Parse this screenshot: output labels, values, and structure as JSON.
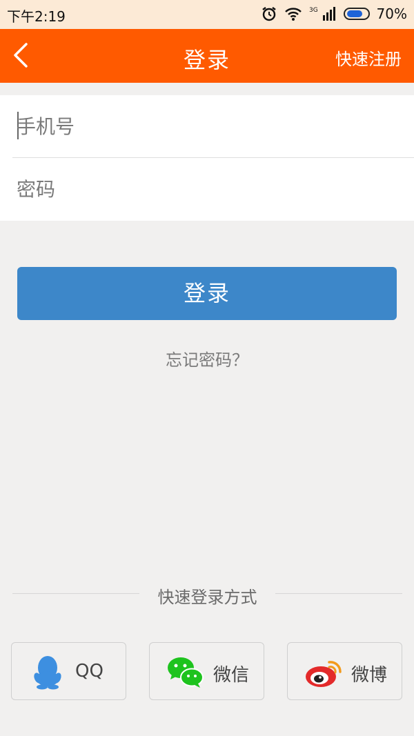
{
  "status_bar": {
    "time": "下午2:19",
    "network": "3G",
    "battery": "70%"
  },
  "header": {
    "title": "登录",
    "register_label": "快速注册"
  },
  "form": {
    "phone_placeholder": "手机号",
    "password_placeholder": "密码"
  },
  "login_button": "登录",
  "forgot_password": "忘记密码？",
  "quick_login": {
    "title": "快速登录方式",
    "options": [
      {
        "label": "QQ",
        "icon": "qq-icon",
        "color": "#3d8fe0"
      },
      {
        "label": "微信",
        "icon": "wechat-icon",
        "color": "#1ec31e"
      },
      {
        "label": "微博",
        "icon": "weibo-icon",
        "color": "#e32a2a"
      }
    ]
  },
  "colors": {
    "header": "#ff5a00",
    "login_button": "#3d87c9",
    "background": "#f1f0ef"
  }
}
